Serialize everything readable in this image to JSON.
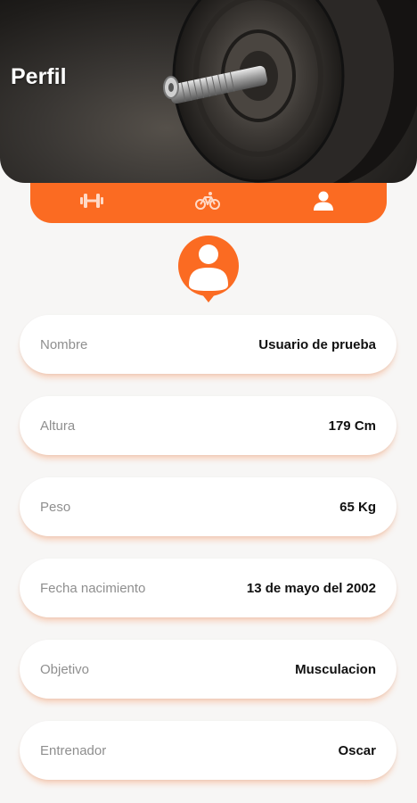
{
  "header": {
    "title": "Perfil",
    "image": "dumbbell-photo"
  },
  "tabs": [
    {
      "icon": "dumbbell-icon",
      "active": false
    },
    {
      "icon": "bicycle-icon",
      "active": false
    },
    {
      "icon": "user-icon",
      "active": true
    }
  ],
  "avatar": {
    "icon": "user-pin-icon"
  },
  "profile": {
    "fields": [
      {
        "label": "Nombre",
        "value": "Usuario de prueba"
      },
      {
        "label": "Altura",
        "value": "179 Cm"
      },
      {
        "label": "Peso",
        "value": "65 Kg"
      },
      {
        "label": "Fecha nacimiento",
        "value": "13 de mayo del 2002"
      },
      {
        "label": "Objetivo",
        "value": "Musculacion"
      },
      {
        "label": "Entrenador",
        "value": "Oscar"
      }
    ]
  },
  "colors": {
    "accent": "#fb6b22",
    "background": "#f7f6f5",
    "card": "#ffffff"
  }
}
